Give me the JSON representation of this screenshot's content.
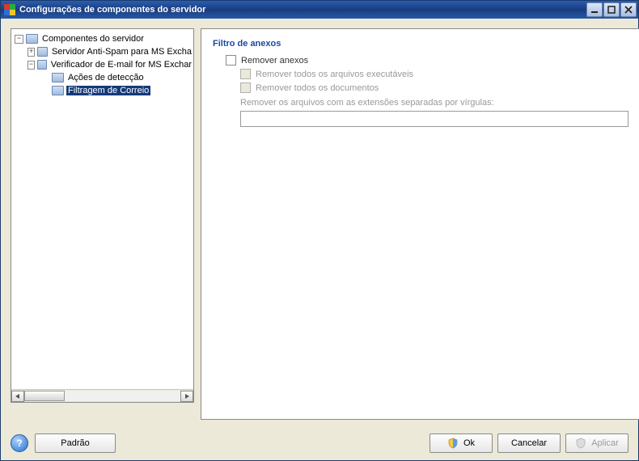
{
  "window": {
    "title": "Configurações de componentes do servidor"
  },
  "tree": {
    "root": "Componentes do servidor",
    "node_antispam": "Servidor Anti-Spam para MS Excha",
    "node_emailverifier": "Verificador de E-mail for MS Exchar",
    "node_detection": "Ações de detecção",
    "node_mailfilter": "Filtragem de Correio"
  },
  "panel": {
    "group_title": "Filtro de anexos",
    "chk_remove": "Remover anexos",
    "chk_remove_exec": "Remover todos os arquivos executáveis",
    "chk_remove_docs": "Remover todos os documentos",
    "ext_label": "Remover os arquivos com as extensões separadas por vírgulas:",
    "ext_value": ""
  },
  "buttons": {
    "default": "Padrão",
    "ok": "Ok",
    "cancel": "Cancelar",
    "apply": "Aplicar"
  }
}
